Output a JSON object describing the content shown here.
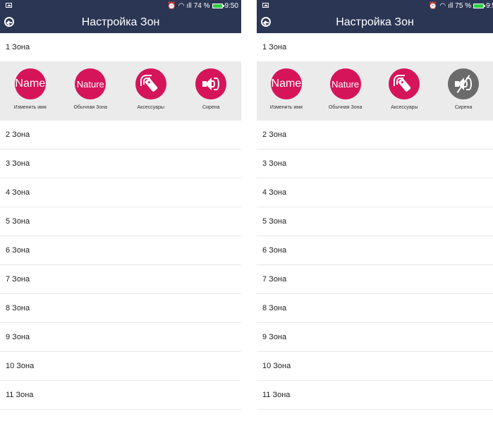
{
  "left": {
    "status": {
      "signal": "ıll",
      "battery_pct": "74 %",
      "time": "9:50"
    },
    "appbar": {
      "title": "Настройка Зон"
    },
    "expanded_zone": "1 Зона",
    "actions": [
      {
        "circle_text": "Name",
        "label": "Изменить имя"
      },
      {
        "circle_text": "Nature",
        "label": "Обычная Зона"
      },
      {
        "circle_text": "",
        "label": "Аксессуары"
      },
      {
        "circle_text": "",
        "label": "Сирена"
      }
    ],
    "zones": [
      "2 Зона",
      "3 Зона",
      "4 Зона",
      "5 Зона",
      "6 Зона",
      "7 Зона",
      "8 Зона",
      "9 Зона",
      "10 Зона",
      "11 Зона"
    ]
  },
  "right": {
    "status": {
      "signal": "ıll",
      "battery_pct": "75 %",
      "time": "9:5"
    },
    "appbar": {
      "title": "Настройка Зон"
    },
    "expanded_zone": "1 Зона",
    "actions": [
      {
        "circle_text": "Name",
        "label": "Изменить имя"
      },
      {
        "circle_text": "Nature",
        "label": "Обычная Зона"
      },
      {
        "circle_text": "",
        "label": "Аксессуары"
      },
      {
        "circle_text": "",
        "label": "Сирена"
      }
    ],
    "zones": [
      "2 Зона",
      "3 Зона",
      "4 Зона",
      "5 Зона",
      "6 Зона",
      "7 Зона",
      "8 Зона",
      "9 Зона",
      "10 Зона",
      "11 Зона"
    ]
  },
  "icons": {
    "back": "back-arrow-icon",
    "accessories": "remote-control-icon",
    "siren_on": "speaker-icon",
    "siren_off": "speaker-muted-icon"
  },
  "colors": {
    "bar": "#2b3654",
    "accent": "#d6145a",
    "muted": "#6b6b6b",
    "panel": "#ebebeb"
  }
}
